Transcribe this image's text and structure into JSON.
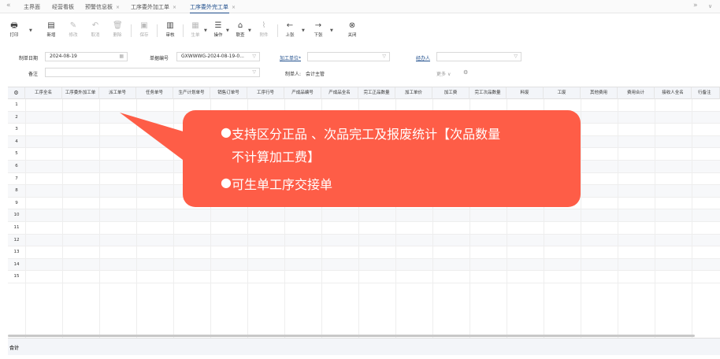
{
  "tabs": {
    "back_glyph": "«",
    "forward_glyph": "»",
    "menu_glyph": "∨",
    "close_glyph": "×",
    "items": [
      {
        "label": "主界面",
        "closable": false
      },
      {
        "label": "经营看板",
        "closable": false
      },
      {
        "label": "预警信息板",
        "closable": true
      },
      {
        "label": "工序委外加工单",
        "closable": true
      },
      {
        "label": "工序委外完工单",
        "closable": true,
        "active": true
      }
    ]
  },
  "toolbar": {
    "print": "打印",
    "new": "新增",
    "edit": "修改",
    "undo": "取消",
    "delete": "删除",
    "save": "保存",
    "review": "审核",
    "generate": "生单",
    "operate": "操作",
    "linked": "联查",
    "attachment": "附件",
    "prev": "上张",
    "next": "下张",
    "close": "关闭"
  },
  "form": {
    "date_label": "制单日期",
    "date_value": "2024-08-19",
    "docno_label": "单据编号",
    "docno_value": "GXWWWG-2024-08-19-0...",
    "unit_label": "加工单位*",
    "unit_value": "",
    "handler_label": "经办人",
    "handler_value": "",
    "note_label": "备注",
    "note_value": "",
    "maker_label": "制单人:",
    "maker_value": "会计主管",
    "more_label": "更多",
    "filter_glyph": "▽",
    "calendar_glyph": "▦",
    "more_glyph": "∨",
    "gear_glyph": "⚙"
  },
  "grid": {
    "settings_glyph": "⚙",
    "columns": [
      "工序全名",
      "工序委外加工单",
      "派工单号",
      "任务单号",
      "生产计划单号",
      "销售订单号",
      "工序行号",
      "产成品编号",
      "产成品全名",
      "完工正品数量",
      "加工单价",
      "加工费",
      "完工次品数量",
      "料废",
      "工废",
      "其他费用",
      "费用合计",
      "接收人全名",
      "行备注"
    ],
    "rows": [
      "1",
      "2",
      "3",
      "4",
      "5",
      "6",
      "7",
      "8",
      "9",
      "10",
      "11",
      "12",
      "13",
      "14",
      "15"
    ],
    "sum_label": "合计"
  },
  "callout": {
    "bullet": "●",
    "line1": "支持区分正品 、次品完工及报废统计【次品数量",
    "line1b": "不计算加工费】",
    "line2": "可生单工序交接单",
    "color": "#fe5d47"
  }
}
